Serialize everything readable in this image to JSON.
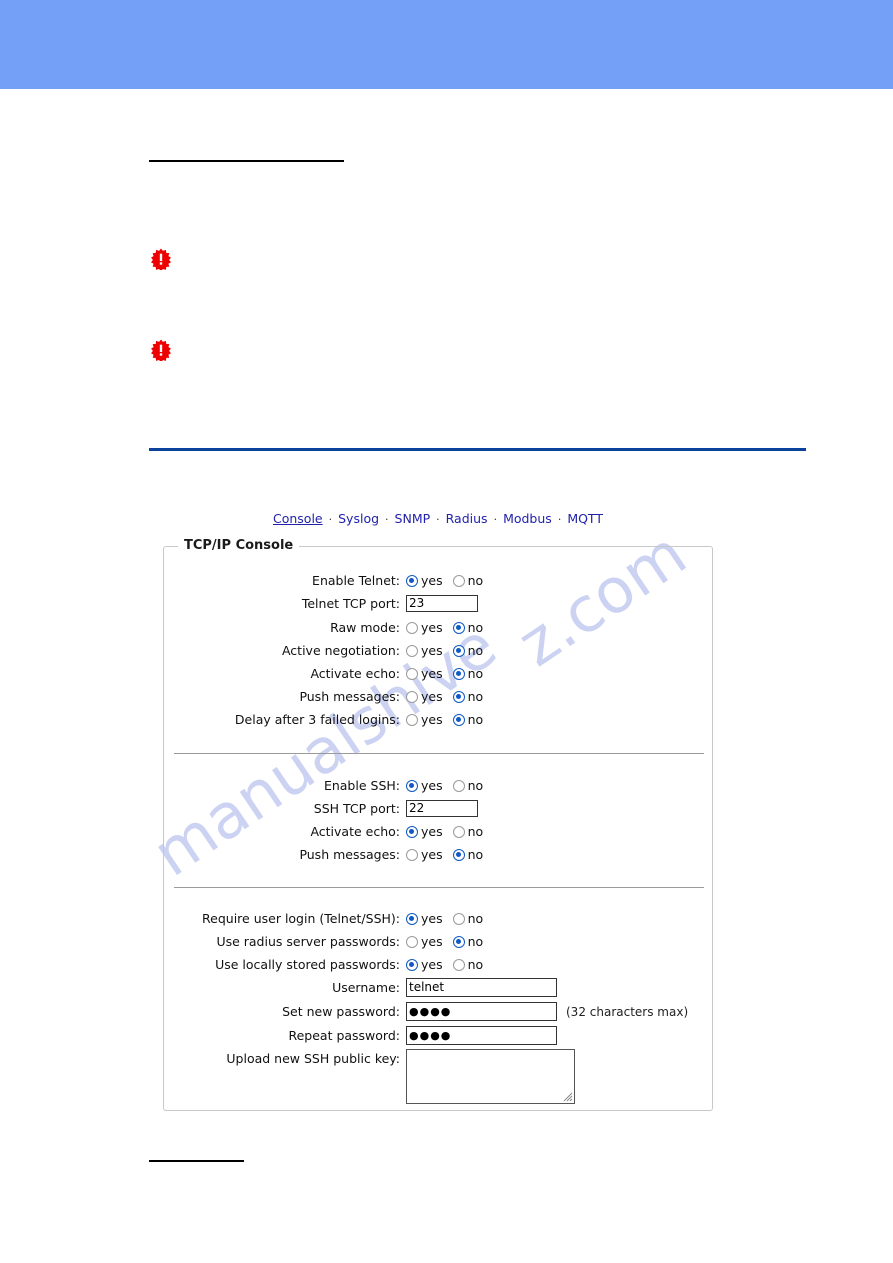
{
  "page": {
    "watermark_left": "manualshive",
    "watermark_right": "z.com"
  },
  "nav": {
    "separator": "·",
    "items": [
      {
        "label": "Console",
        "active": true
      },
      {
        "label": "Syslog",
        "active": false
      },
      {
        "label": "SNMP",
        "active": false
      },
      {
        "label": "Radius",
        "active": false
      },
      {
        "label": "Modbus",
        "active": false
      },
      {
        "label": "MQTT",
        "active": false
      }
    ]
  },
  "fieldset": {
    "legend": "TCP/IP Console"
  },
  "options": {
    "yes": "yes",
    "no": "no"
  },
  "telnet_section": {
    "rows": [
      {
        "label": "Enable Telnet:",
        "type": "radio",
        "value": "yes"
      },
      {
        "label": "Telnet TCP port:",
        "type": "text",
        "value": "23"
      },
      {
        "label": "Raw mode:",
        "type": "radio",
        "value": "no"
      },
      {
        "label": "Active negotiation:",
        "type": "radio",
        "value": "no"
      },
      {
        "label": "Activate echo:",
        "type": "radio",
        "value": "no"
      },
      {
        "label": "Push messages:",
        "type": "radio",
        "value": "no"
      },
      {
        "label": "Delay after 3 failed logins:",
        "type": "radio",
        "value": "no"
      }
    ]
  },
  "ssh_section": {
    "rows": [
      {
        "label": "Enable SSH:",
        "type": "radio",
        "value": "yes"
      },
      {
        "label": "SSH TCP port:",
        "type": "text",
        "value": "22"
      },
      {
        "label": "Activate echo:",
        "type": "radio",
        "value": "yes"
      },
      {
        "label": "Push messages:",
        "type": "radio",
        "value": "no"
      }
    ]
  },
  "login_section": {
    "rows": [
      {
        "label": "Require user login (Telnet/SSH):",
        "type": "radio",
        "value": "yes"
      },
      {
        "label": "Use radius server passwords:",
        "type": "radio",
        "value": "no"
      },
      {
        "label": "Use locally stored passwords:",
        "type": "radio",
        "value": "yes"
      }
    ],
    "username": {
      "label": "Username:",
      "value": "telnet"
    },
    "new_password": {
      "label": "Set new password:",
      "value": "●●●●",
      "hint": "(32 characters max)"
    },
    "repeat_password": {
      "label": "Repeat password:",
      "value": "●●●●"
    },
    "ssh_key": {
      "label": "Upload new SSH public key:",
      "value": ""
    }
  },
  "colors": {
    "header_band": "#74a0f8",
    "blue_rule": "#0b429b",
    "link": "#2222aa",
    "radio_selected": "#1059c4",
    "warning": "#ee0000",
    "watermark": "#ccd2f2"
  }
}
